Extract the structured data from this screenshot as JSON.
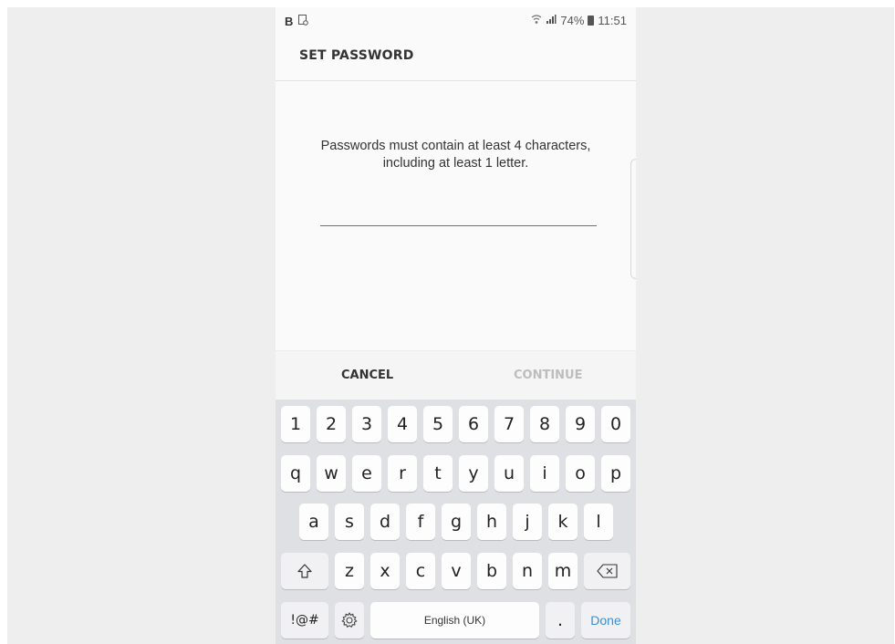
{
  "status_bar": {
    "left_letter": "B",
    "left_icon": "screenshot-icon",
    "wifi_icon": "wifi-icon",
    "signal_icon": "signal-icon",
    "battery": "74%",
    "battery_icon": "battery-icon",
    "time": "11:51"
  },
  "header": {
    "title": "SET PASSWORD"
  },
  "content": {
    "instructions": "Passwords must contain at least 4 characters, including at least 1 letter.",
    "password_value": "",
    "password_placeholder": ""
  },
  "buttons": {
    "cancel": "CANCEL",
    "continue": "CONTINUE"
  },
  "keyboard": {
    "row_numbers": [
      "1",
      "2",
      "3",
      "4",
      "5",
      "6",
      "7",
      "8",
      "9",
      "0"
    ],
    "row_top": [
      "q",
      "w",
      "e",
      "r",
      "t",
      "y",
      "u",
      "i",
      "o",
      "p"
    ],
    "row_middle": [
      "a",
      "s",
      "d",
      "f",
      "g",
      "h",
      "j",
      "k",
      "l"
    ],
    "row_bottom": [
      "z",
      "x",
      "c",
      "v",
      "b",
      "n",
      "m"
    ],
    "shift_icon": "shift-icon",
    "backspace_icon": "backspace-icon",
    "symbols_label": "!@#",
    "settings_icon": "gear-icon",
    "space_label": "English (UK)",
    "period_label": ".",
    "done_label": "Done"
  },
  "colors": {
    "accent": "#4a6fd9",
    "done_text": "#3a8fd6",
    "keyboard_bg": "#dfe0e3",
    "continue_disabled": "#bdbdbd"
  }
}
